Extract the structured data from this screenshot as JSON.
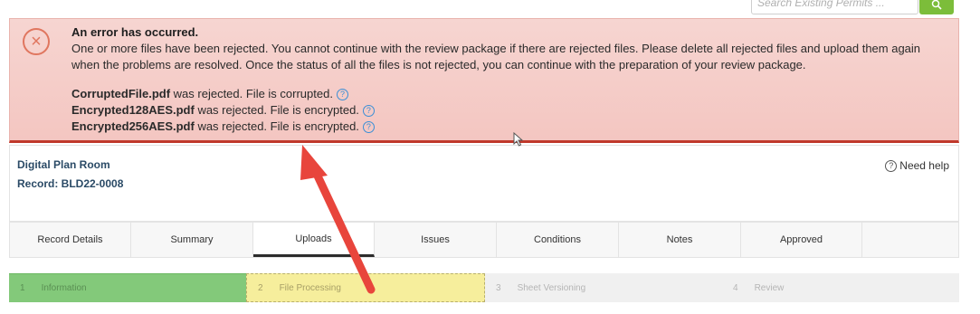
{
  "search": {
    "placeholder": "Search Existing Permits ...",
    "button_icon": "search-icon"
  },
  "error": {
    "icon": "close-circle-icon",
    "title": "An error has occurred.",
    "message": "One or more files have been rejected. You cannot continue with the review package if there are rejected files. Please delete all rejected files and upload them again when the problems are resolved. Once the status of all the files is not rejected, you can continue with the preparation of your review package.",
    "rejected": [
      {
        "file": "CorruptedFile.pdf",
        "reason": " was rejected. File is corrupted."
      },
      {
        "file": "Encrypted128AES.pdf",
        "reason": " was rejected. File is encrypted."
      },
      {
        "file": "Encrypted256AES.pdf",
        "reason": " was rejected. File is encrypted."
      }
    ],
    "help_glyph": "?"
  },
  "record": {
    "app_name": "Digital Plan Room",
    "record_label": "Record: BLD22-0008",
    "need_help": "Need help",
    "help_glyph": "?"
  },
  "tabs": [
    {
      "label": "Record Details"
    },
    {
      "label": "Summary"
    },
    {
      "label": "Uploads"
    },
    {
      "label": "Issues"
    },
    {
      "label": "Conditions"
    },
    {
      "label": "Notes"
    },
    {
      "label": "Approved"
    }
  ],
  "active_tab": "Uploads",
  "steps": [
    {
      "num": "1",
      "label": "Information",
      "state": "complete"
    },
    {
      "num": "2",
      "label": "File Processing",
      "state": "current"
    },
    {
      "num": "3",
      "label": "Sheet Versioning",
      "state": "pending"
    },
    {
      "num": "4",
      "label": "Review",
      "state": "pending"
    }
  ],
  "colors": {
    "error_bg": "#f6d5d1",
    "error_border": "#c0392b",
    "accent_green": "#7cbd3a",
    "arrow": "#e8453c",
    "step_complete": "#83c97a",
    "step_current": "#f6ee9c"
  }
}
